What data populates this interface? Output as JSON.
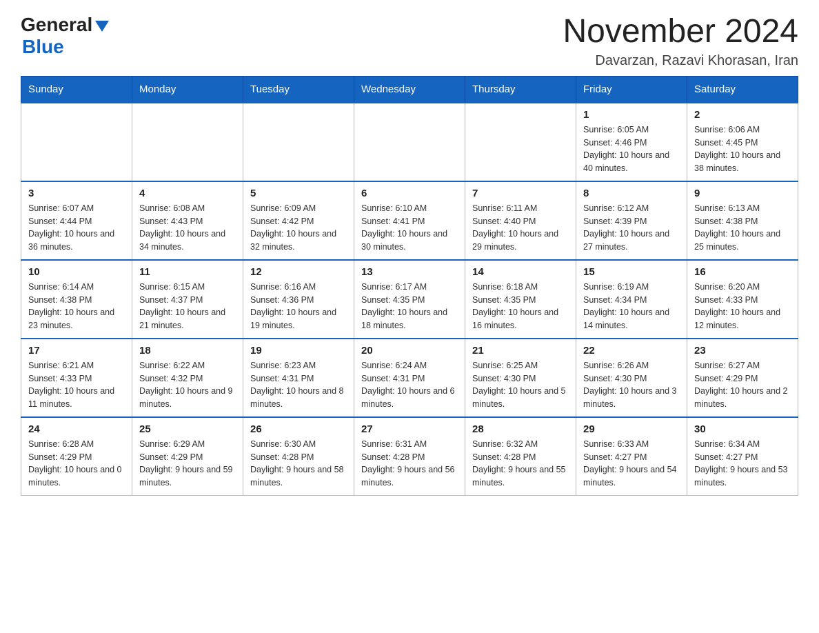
{
  "header": {
    "logo_general": "General",
    "logo_blue": "Blue",
    "month_title": "November 2024",
    "location": "Davarzan, Razavi Khorasan, Iran"
  },
  "weekdays": [
    "Sunday",
    "Monday",
    "Tuesday",
    "Wednesday",
    "Thursday",
    "Friday",
    "Saturday"
  ],
  "weeks": [
    [
      {
        "day": "",
        "info": ""
      },
      {
        "day": "",
        "info": ""
      },
      {
        "day": "",
        "info": ""
      },
      {
        "day": "",
        "info": ""
      },
      {
        "day": "",
        "info": ""
      },
      {
        "day": "1",
        "info": "Sunrise: 6:05 AM\nSunset: 4:46 PM\nDaylight: 10 hours and 40 minutes."
      },
      {
        "day": "2",
        "info": "Sunrise: 6:06 AM\nSunset: 4:45 PM\nDaylight: 10 hours and 38 minutes."
      }
    ],
    [
      {
        "day": "3",
        "info": "Sunrise: 6:07 AM\nSunset: 4:44 PM\nDaylight: 10 hours and 36 minutes."
      },
      {
        "day": "4",
        "info": "Sunrise: 6:08 AM\nSunset: 4:43 PM\nDaylight: 10 hours and 34 minutes."
      },
      {
        "day": "5",
        "info": "Sunrise: 6:09 AM\nSunset: 4:42 PM\nDaylight: 10 hours and 32 minutes."
      },
      {
        "day": "6",
        "info": "Sunrise: 6:10 AM\nSunset: 4:41 PM\nDaylight: 10 hours and 30 minutes."
      },
      {
        "day": "7",
        "info": "Sunrise: 6:11 AM\nSunset: 4:40 PM\nDaylight: 10 hours and 29 minutes."
      },
      {
        "day": "8",
        "info": "Sunrise: 6:12 AM\nSunset: 4:39 PM\nDaylight: 10 hours and 27 minutes."
      },
      {
        "day": "9",
        "info": "Sunrise: 6:13 AM\nSunset: 4:38 PM\nDaylight: 10 hours and 25 minutes."
      }
    ],
    [
      {
        "day": "10",
        "info": "Sunrise: 6:14 AM\nSunset: 4:38 PM\nDaylight: 10 hours and 23 minutes."
      },
      {
        "day": "11",
        "info": "Sunrise: 6:15 AM\nSunset: 4:37 PM\nDaylight: 10 hours and 21 minutes."
      },
      {
        "day": "12",
        "info": "Sunrise: 6:16 AM\nSunset: 4:36 PM\nDaylight: 10 hours and 19 minutes."
      },
      {
        "day": "13",
        "info": "Sunrise: 6:17 AM\nSunset: 4:35 PM\nDaylight: 10 hours and 18 minutes."
      },
      {
        "day": "14",
        "info": "Sunrise: 6:18 AM\nSunset: 4:35 PM\nDaylight: 10 hours and 16 minutes."
      },
      {
        "day": "15",
        "info": "Sunrise: 6:19 AM\nSunset: 4:34 PM\nDaylight: 10 hours and 14 minutes."
      },
      {
        "day": "16",
        "info": "Sunrise: 6:20 AM\nSunset: 4:33 PM\nDaylight: 10 hours and 12 minutes."
      }
    ],
    [
      {
        "day": "17",
        "info": "Sunrise: 6:21 AM\nSunset: 4:33 PM\nDaylight: 10 hours and 11 minutes."
      },
      {
        "day": "18",
        "info": "Sunrise: 6:22 AM\nSunset: 4:32 PM\nDaylight: 10 hours and 9 minutes."
      },
      {
        "day": "19",
        "info": "Sunrise: 6:23 AM\nSunset: 4:31 PM\nDaylight: 10 hours and 8 minutes."
      },
      {
        "day": "20",
        "info": "Sunrise: 6:24 AM\nSunset: 4:31 PM\nDaylight: 10 hours and 6 minutes."
      },
      {
        "day": "21",
        "info": "Sunrise: 6:25 AM\nSunset: 4:30 PM\nDaylight: 10 hours and 5 minutes."
      },
      {
        "day": "22",
        "info": "Sunrise: 6:26 AM\nSunset: 4:30 PM\nDaylight: 10 hours and 3 minutes."
      },
      {
        "day": "23",
        "info": "Sunrise: 6:27 AM\nSunset: 4:29 PM\nDaylight: 10 hours and 2 minutes."
      }
    ],
    [
      {
        "day": "24",
        "info": "Sunrise: 6:28 AM\nSunset: 4:29 PM\nDaylight: 10 hours and 0 minutes."
      },
      {
        "day": "25",
        "info": "Sunrise: 6:29 AM\nSunset: 4:29 PM\nDaylight: 9 hours and 59 minutes."
      },
      {
        "day": "26",
        "info": "Sunrise: 6:30 AM\nSunset: 4:28 PM\nDaylight: 9 hours and 58 minutes."
      },
      {
        "day": "27",
        "info": "Sunrise: 6:31 AM\nSunset: 4:28 PM\nDaylight: 9 hours and 56 minutes."
      },
      {
        "day": "28",
        "info": "Sunrise: 6:32 AM\nSunset: 4:28 PM\nDaylight: 9 hours and 55 minutes."
      },
      {
        "day": "29",
        "info": "Sunrise: 6:33 AM\nSunset: 4:27 PM\nDaylight: 9 hours and 54 minutes."
      },
      {
        "day": "30",
        "info": "Sunrise: 6:34 AM\nSunset: 4:27 PM\nDaylight: 9 hours and 53 minutes."
      }
    ]
  ]
}
